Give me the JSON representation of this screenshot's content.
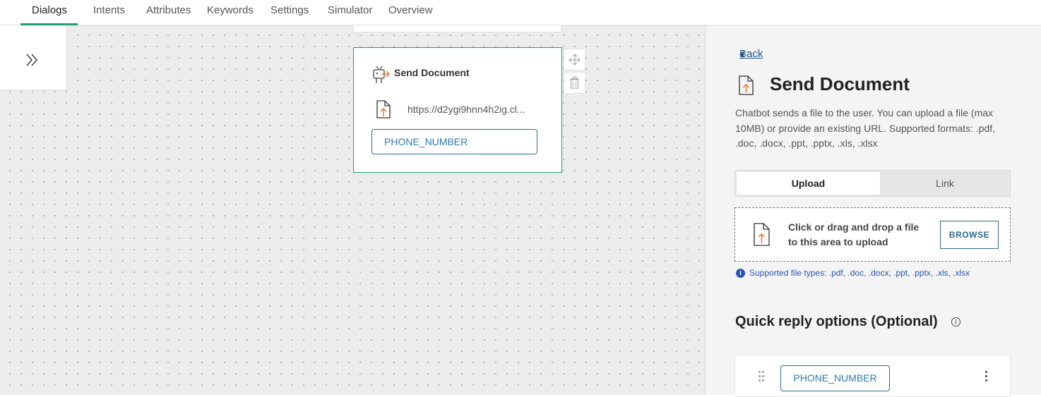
{
  "nav": {
    "tabs": [
      {
        "label": "Dialogs",
        "active": true
      },
      {
        "label": "Intents"
      },
      {
        "label": "Attributes"
      },
      {
        "label": "Keywords"
      },
      {
        "label": "Settings"
      },
      {
        "label": "Simulator"
      },
      {
        "label": "Overview"
      }
    ]
  },
  "canvas": {
    "node": {
      "title": "Send Document",
      "url": "https://d2ygi9hnn4h2ig.cl...",
      "chip": "PHONE_NUMBER"
    }
  },
  "panel": {
    "back_label": "Back",
    "title": "Send Document",
    "description": "Chatbot sends a file to the user. You can upload a file (max 10MB) or provide an existing URL. Supported formats: .pdf, .doc, .docx, .ppt, .pptx, .xls, .xlsx",
    "tabs": {
      "upload": "Upload",
      "link": "Link"
    },
    "dropzone_text": "Click or drag and drop a file to this area to upload",
    "browse_label": "BROWSE",
    "supported_types": "Supported file types: .pdf, .doc, .docx, .ppt, .pptx, .xls, .xlsx",
    "quick_reply_title": "Quick reply options (Optional)",
    "quick_reply_chip": "PHONE_NUMBER"
  },
  "colors": {
    "accent": "#1e9e77",
    "link": "#21598a",
    "chip_border": "#2b6a8f",
    "info": "#2a55b8",
    "upload_arrow": "#e8712a"
  }
}
